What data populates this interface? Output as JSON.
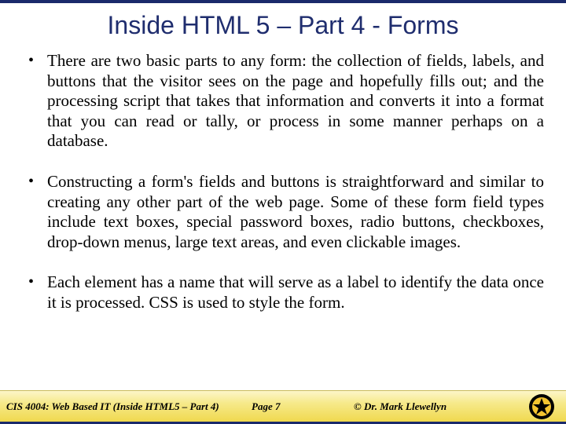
{
  "title": "Inside HTML 5 – Part 4 - Forms",
  "bullets": [
    "There are two basic parts to any form: the collection of fields, labels, and buttons that the visitor sees on the page and hopefully fills out; and the processing script that takes that information and converts it into a format that you can read or tally, or process in some manner perhaps on a database.",
    "Constructing a form's fields and buttons is straightforward and similar to creating any other part of the web page.  Some of these form field types include text boxes, special password boxes, radio buttons, checkboxes, drop-down menus, large text areas, and even clickable images.",
    "Each element has a name that will serve as a label to identify the data once it is processed.  CSS is used to style the form."
  ],
  "footer": {
    "course": "CIS 4004: Web Based IT (Inside HTML5 – Part 4)",
    "page": "Page 7",
    "author": "© Dr. Mark Llewellyn"
  }
}
